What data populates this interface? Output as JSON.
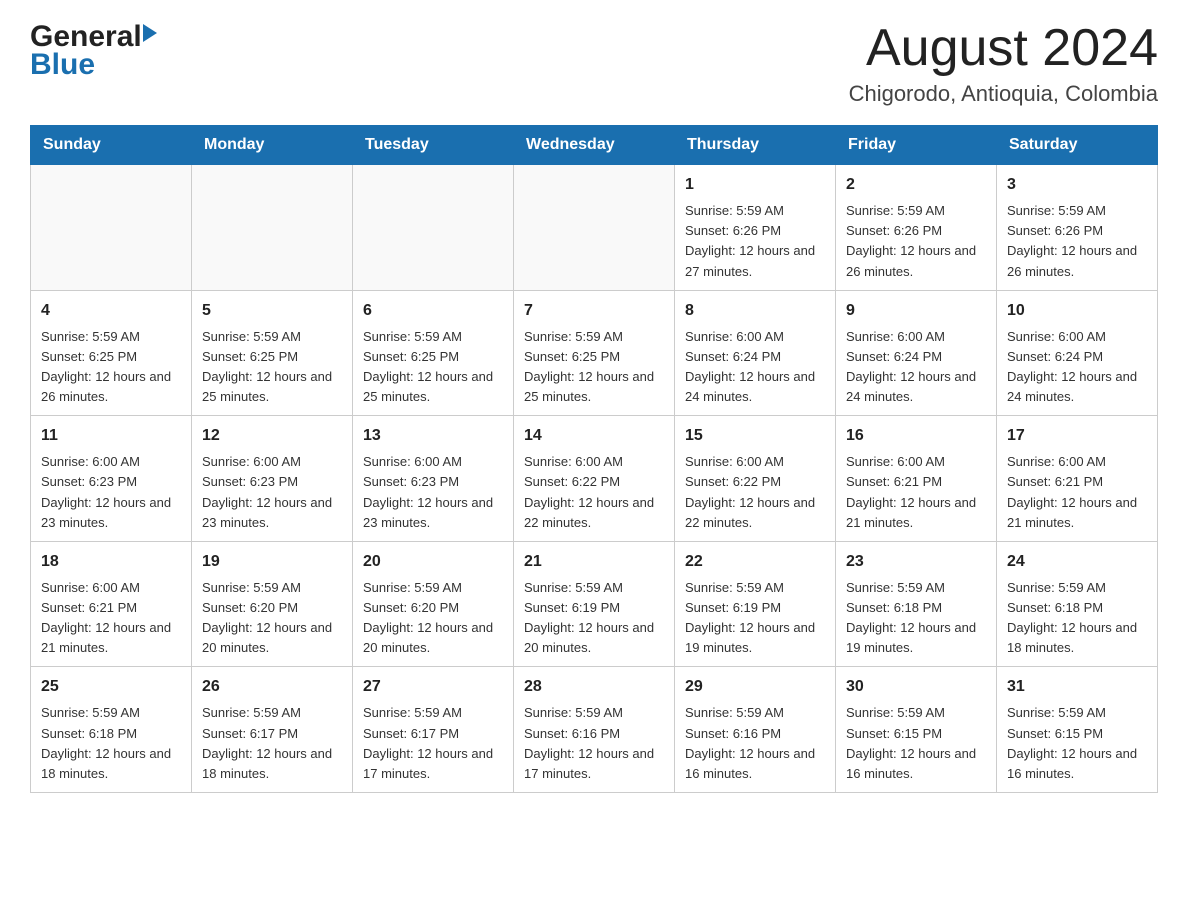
{
  "header": {
    "month_title": "August 2024",
    "location": "Chigorodo, Antioquia, Colombia",
    "logo_general": "General",
    "logo_blue": "Blue"
  },
  "weekdays": [
    "Sunday",
    "Monday",
    "Tuesday",
    "Wednesday",
    "Thursday",
    "Friday",
    "Saturday"
  ],
  "weeks": [
    [
      {
        "day": "",
        "info": ""
      },
      {
        "day": "",
        "info": ""
      },
      {
        "day": "",
        "info": ""
      },
      {
        "day": "",
        "info": ""
      },
      {
        "day": "1",
        "info": "Sunrise: 5:59 AM\nSunset: 6:26 PM\nDaylight: 12 hours and 27 minutes."
      },
      {
        "day": "2",
        "info": "Sunrise: 5:59 AM\nSunset: 6:26 PM\nDaylight: 12 hours and 26 minutes."
      },
      {
        "day": "3",
        "info": "Sunrise: 5:59 AM\nSunset: 6:26 PM\nDaylight: 12 hours and 26 minutes."
      }
    ],
    [
      {
        "day": "4",
        "info": "Sunrise: 5:59 AM\nSunset: 6:25 PM\nDaylight: 12 hours and 26 minutes."
      },
      {
        "day": "5",
        "info": "Sunrise: 5:59 AM\nSunset: 6:25 PM\nDaylight: 12 hours and 25 minutes."
      },
      {
        "day": "6",
        "info": "Sunrise: 5:59 AM\nSunset: 6:25 PM\nDaylight: 12 hours and 25 minutes."
      },
      {
        "day": "7",
        "info": "Sunrise: 5:59 AM\nSunset: 6:25 PM\nDaylight: 12 hours and 25 minutes."
      },
      {
        "day": "8",
        "info": "Sunrise: 6:00 AM\nSunset: 6:24 PM\nDaylight: 12 hours and 24 minutes."
      },
      {
        "day": "9",
        "info": "Sunrise: 6:00 AM\nSunset: 6:24 PM\nDaylight: 12 hours and 24 minutes."
      },
      {
        "day": "10",
        "info": "Sunrise: 6:00 AM\nSunset: 6:24 PM\nDaylight: 12 hours and 24 minutes."
      }
    ],
    [
      {
        "day": "11",
        "info": "Sunrise: 6:00 AM\nSunset: 6:23 PM\nDaylight: 12 hours and 23 minutes."
      },
      {
        "day": "12",
        "info": "Sunrise: 6:00 AM\nSunset: 6:23 PM\nDaylight: 12 hours and 23 minutes."
      },
      {
        "day": "13",
        "info": "Sunrise: 6:00 AM\nSunset: 6:23 PM\nDaylight: 12 hours and 23 minutes."
      },
      {
        "day": "14",
        "info": "Sunrise: 6:00 AM\nSunset: 6:22 PM\nDaylight: 12 hours and 22 minutes."
      },
      {
        "day": "15",
        "info": "Sunrise: 6:00 AM\nSunset: 6:22 PM\nDaylight: 12 hours and 22 minutes."
      },
      {
        "day": "16",
        "info": "Sunrise: 6:00 AM\nSunset: 6:21 PM\nDaylight: 12 hours and 21 minutes."
      },
      {
        "day": "17",
        "info": "Sunrise: 6:00 AM\nSunset: 6:21 PM\nDaylight: 12 hours and 21 minutes."
      }
    ],
    [
      {
        "day": "18",
        "info": "Sunrise: 6:00 AM\nSunset: 6:21 PM\nDaylight: 12 hours and 21 minutes."
      },
      {
        "day": "19",
        "info": "Sunrise: 5:59 AM\nSunset: 6:20 PM\nDaylight: 12 hours and 20 minutes."
      },
      {
        "day": "20",
        "info": "Sunrise: 5:59 AM\nSunset: 6:20 PM\nDaylight: 12 hours and 20 minutes."
      },
      {
        "day": "21",
        "info": "Sunrise: 5:59 AM\nSunset: 6:19 PM\nDaylight: 12 hours and 20 minutes."
      },
      {
        "day": "22",
        "info": "Sunrise: 5:59 AM\nSunset: 6:19 PM\nDaylight: 12 hours and 19 minutes."
      },
      {
        "day": "23",
        "info": "Sunrise: 5:59 AM\nSunset: 6:18 PM\nDaylight: 12 hours and 19 minutes."
      },
      {
        "day": "24",
        "info": "Sunrise: 5:59 AM\nSunset: 6:18 PM\nDaylight: 12 hours and 18 minutes."
      }
    ],
    [
      {
        "day": "25",
        "info": "Sunrise: 5:59 AM\nSunset: 6:18 PM\nDaylight: 12 hours and 18 minutes."
      },
      {
        "day": "26",
        "info": "Sunrise: 5:59 AM\nSunset: 6:17 PM\nDaylight: 12 hours and 18 minutes."
      },
      {
        "day": "27",
        "info": "Sunrise: 5:59 AM\nSunset: 6:17 PM\nDaylight: 12 hours and 17 minutes."
      },
      {
        "day": "28",
        "info": "Sunrise: 5:59 AM\nSunset: 6:16 PM\nDaylight: 12 hours and 17 minutes."
      },
      {
        "day": "29",
        "info": "Sunrise: 5:59 AM\nSunset: 6:16 PM\nDaylight: 12 hours and 16 minutes."
      },
      {
        "day": "30",
        "info": "Sunrise: 5:59 AM\nSunset: 6:15 PM\nDaylight: 12 hours and 16 minutes."
      },
      {
        "day": "31",
        "info": "Sunrise: 5:59 AM\nSunset: 6:15 PM\nDaylight: 12 hours and 16 minutes."
      }
    ]
  ]
}
